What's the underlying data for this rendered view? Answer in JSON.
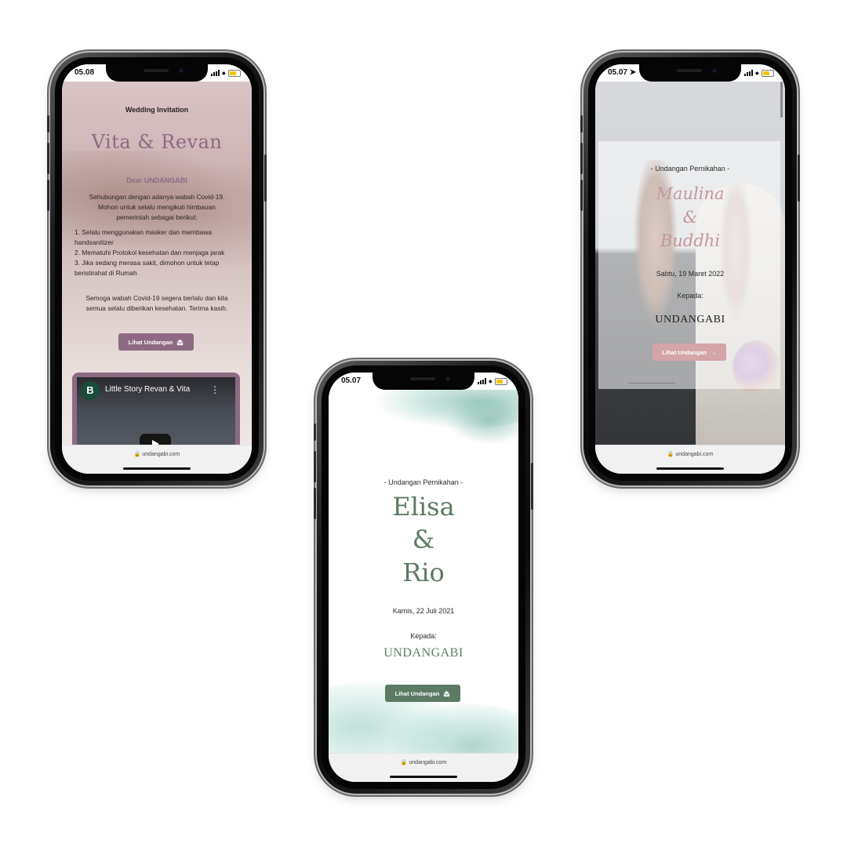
{
  "phone_left": {
    "status_time": "05.08",
    "url": "undangabi.com",
    "header": "Wedding Invitation",
    "couple": "Vita & Revan",
    "greeting": "Dear UNDANGABI",
    "intro_lines": [
      "Sehubungan dengan adanya wabah Covid-19.",
      "Mohon untuk selalu mengikuti himbauan",
      "pemerintah sebagai berikut:"
    ],
    "rules": [
      "1. Selalu menggunakan masker dan membawa handsanitizer",
      "2. Mematuhi Protokol kesehatan dan menjaga jarak",
      "3. Jika sedang merasa sakit, dimohon untuk tetap beristirahat di Rumah"
    ],
    "closing_lines": [
      "Semoga wabah Covid-19 segera berlalu dan kita",
      "semua selalu diberikan kesehatan. Terima kasih."
    ],
    "button_label": "Lihat Undangan",
    "button_icon": "envelope-open-icon",
    "video": {
      "channel_initial": "B",
      "title": "Little Story Revan & Vita"
    },
    "accent_color": "#8d6a82"
  },
  "phone_center": {
    "status_time": "05.07",
    "url": "undangabi.com",
    "subtitle": "- Undangan Pernikahan -",
    "bride": "Elisa",
    "ampersand": "&",
    "groom": "Rio",
    "date": "Kamis, 22 Juli 2021",
    "to_label": "Kepada:",
    "guest": "UNDANGABI",
    "button_label": "Lihat Undangan",
    "button_icon": "envelope-open-icon",
    "accent_color": "#5c7a64"
  },
  "phone_right": {
    "status_time": "05.07",
    "url": "undangabi.com",
    "subtitle": "- Undangan Pernikahan -",
    "bride": "Maulina",
    "ampersand": "&",
    "groom": "Buddhi",
    "date": "Sabtu, 19 Maret 2022",
    "to_label": "Kepada:",
    "guest": "UNDANGABI",
    "button_label": "Lihat Undangan",
    "button_icon": "arrow-right-icon",
    "accent_color": "#d5a4a8"
  }
}
